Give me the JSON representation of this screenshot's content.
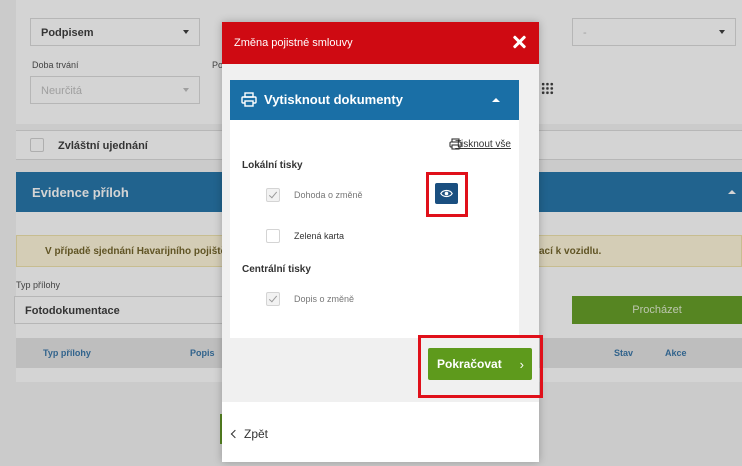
{
  "background": {
    "signed_select": "Podpisem",
    "duration_label": "Doba trvání",
    "duration_value": "Neurčitá",
    "partial_label": "Po",
    "dash_value": "-",
    "special_label": "Zvláštní ujednání",
    "evidence_title": "Evidence příloh",
    "warning_text_left": "V případě sjednání Havarijního pojištěn",
    "warning_text_right": "ací k vozidlu.",
    "type_label": "Typ přílohy",
    "type_value": "Fotodokumentace",
    "browse_label": "Procházet",
    "table_headers": {
      "type": "Typ přílohy",
      "desc": "Popis",
      "status": "Stav",
      "action": "Akce"
    }
  },
  "modal": {
    "title": "Změna pojistné smlouvy",
    "section_title": "Vytisknout dokumenty",
    "print_all": "Tisknout vše",
    "local_prints_title": "Lokální tisky",
    "local_items": [
      {
        "label": "Dohoda o změně",
        "checked": true
      },
      {
        "label": "Zelená karta",
        "checked": false
      }
    ],
    "central_prints_title": "Centrální tisky",
    "central_items": [
      {
        "label": "Dopis o změně",
        "checked": true
      }
    ],
    "continue_label": "Pokračovat",
    "continue_arrow": "›",
    "back_label": "Zpět"
  },
  "colors": {
    "header_red": "#cf0a12",
    "panel_blue": "#1a6fa6",
    "eye_button": "#1a4f80",
    "continue_green": "#5e9a1c",
    "highlight_red": "#e0101a"
  }
}
